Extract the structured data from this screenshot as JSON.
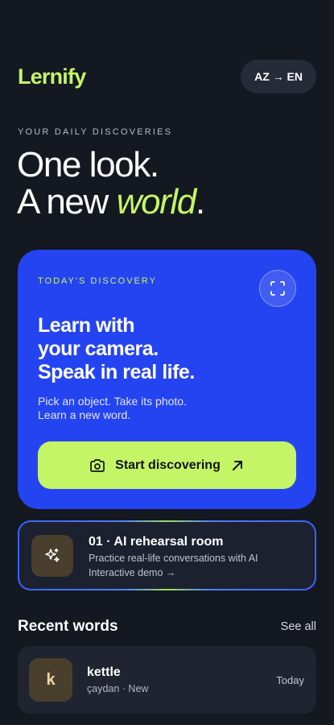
{
  "header": {
    "logo": "Lernify",
    "language_pair": "AZ → EN"
  },
  "intro": {
    "eyebrow": "YOUR DAILY DISCOVERIES",
    "headline_line1": "One look.",
    "headline_line2_prefix": "A new ",
    "headline_accent": "world",
    "headline_suffix": "."
  },
  "discovery_card": {
    "eyebrow": "TODAY'S DISCOVERY",
    "title_line1": "Learn with",
    "title_line2": "your camera.",
    "title_line3": "Speak in real life.",
    "subtitle_line1": "Pick an object. Take its photo.",
    "subtitle_line2": "Learn a new word.",
    "cta_label": "Start discovering",
    "scan_icon": "scan-frame-icon"
  },
  "ai_card": {
    "title": "01 · AI rehearsal room",
    "description": "Practice real-life conversations with AI",
    "link": "Interactive demo →",
    "icon": "sparkle-icon"
  },
  "recent": {
    "title": "Recent words",
    "see_all": "See all",
    "words": [
      {
        "letter": "k",
        "term": "kettle",
        "meta": "çaydan · New",
        "date": "Today"
      }
    ]
  },
  "colors": {
    "background": "#141820",
    "accent": "#c4f566",
    "card_blue": "#2544f1"
  }
}
